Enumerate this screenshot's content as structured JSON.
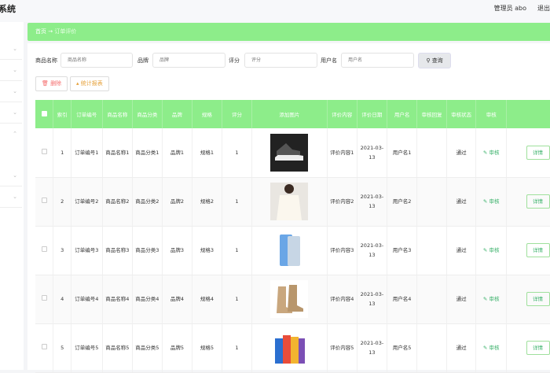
{
  "header": {
    "title": "系统",
    "user": "管理员 abo",
    "logout": "退出登"
  },
  "breadcrumb": {
    "home": "首页",
    "arrow": "→",
    "current": "订单评价"
  },
  "search": {
    "fields": [
      {
        "label": "商品名称",
        "placeholder": "商品名称"
      },
      {
        "label": "品牌",
        "placeholder": "品牌"
      },
      {
        "label": "评分",
        "placeholder": "评分"
      },
      {
        "label": "用户名",
        "placeholder": "用户名"
      }
    ],
    "query_label": "查询"
  },
  "actions": {
    "delete_label": "删除",
    "stats_label": "统计报表",
    "delete_color": "#f56c6c",
    "stats_color": "#e6a23c"
  },
  "table": {
    "columns": [
      "",
      "索引",
      "订单编号",
      "商品名称",
      "商品分类",
      "品牌",
      "规格",
      "评分",
      "添加图片",
      "评价内容",
      "评价日期",
      "用户名",
      "审核回复",
      "审核状态",
      "审核",
      ""
    ],
    "rows": [
      {
        "index": "1",
        "order": "订单编号1",
        "name": "商品名称1",
        "category": "商品分类1",
        "brand": "品牌1",
        "spec": "规格1",
        "score": "1",
        "image": "sneakers",
        "content": "评价内容1",
        "date": "2021-03-13",
        "user": "用户名1",
        "reply": "",
        "status": "通过",
        "audit": "审核",
        "detail": "详情"
      },
      {
        "index": "2",
        "order": "订单编号2",
        "name": "商品名称2",
        "category": "商品分类2",
        "brand": "品牌2",
        "spec": "规格2",
        "score": "1",
        "image": "blouse",
        "content": "评价内容2",
        "date": "2021-03-13",
        "user": "用户名2",
        "reply": "",
        "status": "通过",
        "audit": "审核",
        "detail": "详情"
      },
      {
        "index": "3",
        "order": "订单编号3",
        "name": "商品名称3",
        "category": "商品分类3",
        "brand": "品牌3",
        "spec": "规格3",
        "score": "1",
        "image": "phone",
        "content": "评价内容3",
        "date": "2021-03-13",
        "user": "用户名3",
        "reply": "",
        "status": "通过",
        "audit": "审核",
        "detail": "详情"
      },
      {
        "index": "4",
        "order": "订单编号4",
        "name": "商品名称4",
        "category": "商品分类4",
        "brand": "品牌4",
        "spec": "规格4",
        "score": "1",
        "image": "boots",
        "content": "评价内容4",
        "date": "2021-03-13",
        "user": "用户名4",
        "reply": "",
        "status": "通过",
        "audit": "审核",
        "detail": "详情"
      },
      {
        "index": "5",
        "order": "订单编号5",
        "name": "商品名称5",
        "category": "商品分类5",
        "brand": "品牌5",
        "spec": "规格5",
        "score": "1",
        "image": "cartons",
        "content": "评价内容5",
        "date": "2021-03-13",
        "user": "用户名5",
        "reply": "",
        "status": "通过",
        "audit": "审核",
        "detail": "详情"
      }
    ]
  },
  "colors": {
    "accent": "#8ded8a",
    "link": "#3bb26b"
  }
}
